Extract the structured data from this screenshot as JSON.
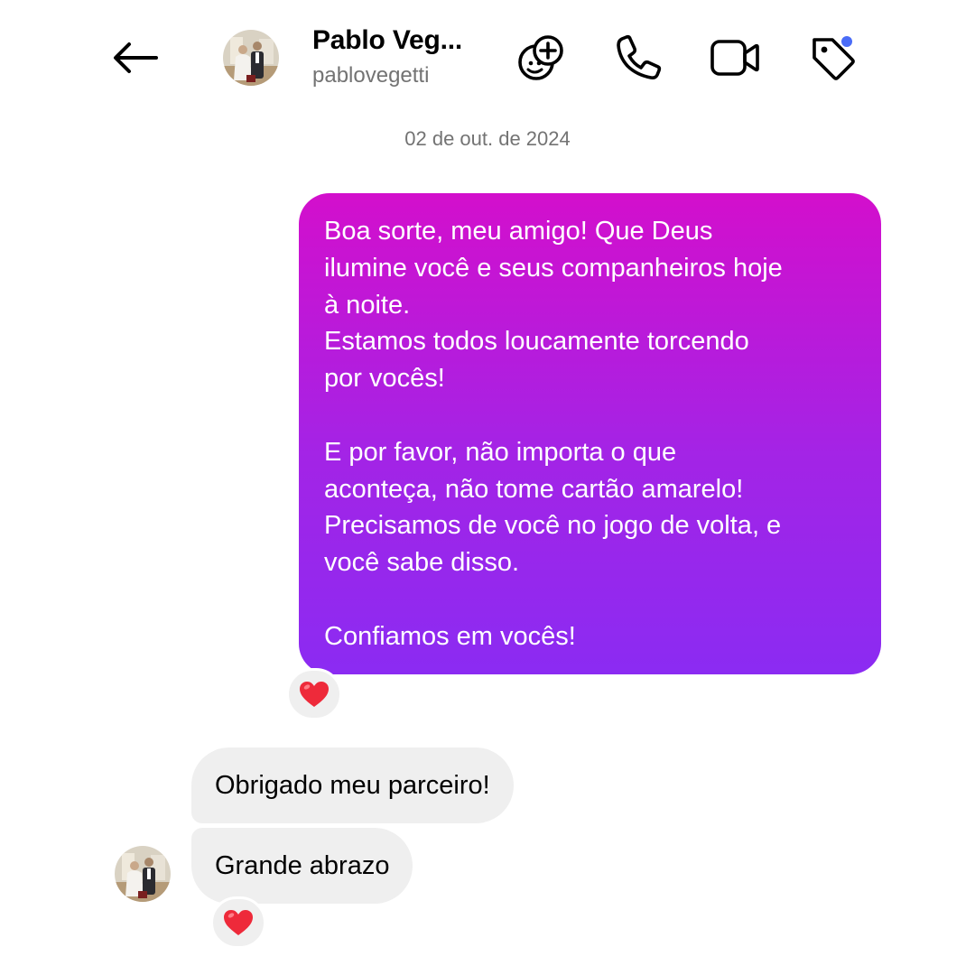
{
  "header": {
    "contact_name": "Pablo Veg...",
    "username": "pablovegetti",
    "icons": [
      "back-arrow-icon",
      "effects-icon",
      "phone-icon",
      "video-icon",
      "tag-icon"
    ],
    "notification_dot_color": "#4a6cf7"
  },
  "conversation": {
    "date_separator": "02 de out. de 2024",
    "sent_message": {
      "text": "Boa sorte, meu amigo! Que Deus\nilumine você e seus companheiros hoje\nà noite.\nEstamos todos loucamente torcendo\npor vocês!\n\nE por favor, não importa o que\naconteça, não tome cartão amarelo!\nPrecisamos de você no jogo de volta, e\nvocê sabe disso.\n\nConfiamos em vocês!",
      "reaction": "❤️",
      "gradient_colors": [
        "#d30fcc",
        "#8b2bf2"
      ]
    },
    "received_messages": [
      {
        "text": "Obrigado meu parceiro!"
      },
      {
        "text": "Grande abrazo",
        "reaction": "❤️"
      }
    ]
  }
}
